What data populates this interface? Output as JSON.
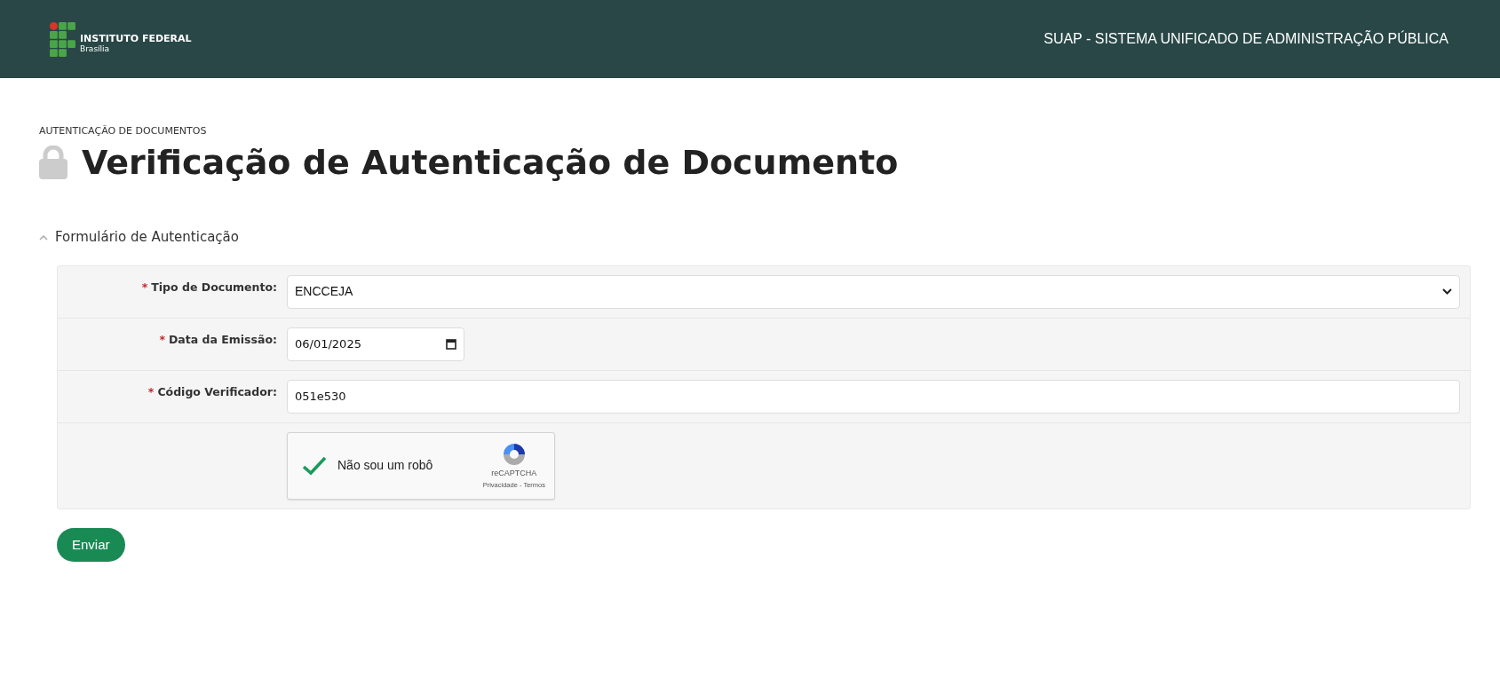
{
  "header": {
    "logo_title": "INSTITUTO FEDERAL",
    "logo_subtitle": "Brasília",
    "system_name": "SUAP - SISTEMA UNIFICADO DE ADMINISTRAÇÃO PÚBLICA"
  },
  "breadcrumb": "AUTENTICAÇÃO DE DOCUMENTOS",
  "page_title": "Verificação de Autenticação de Documento",
  "section": {
    "title": "Formulário de Autenticação",
    "expanded": true
  },
  "fields": [
    {
      "kind": "select",
      "required_mark": "*",
      "label": "Tipo de Documento:",
      "value": "ENCCEJA"
    },
    {
      "kind": "date",
      "required_mark": "*",
      "label": "Data da Emissão:",
      "value": "06/01/2025"
    },
    {
      "kind": "text",
      "required_mark": "*",
      "label": "Código Verificador:",
      "value": "051e530"
    },
    {
      "kind": "captcha",
      "label": "Não sou um robô",
      "checked": true,
      "brand": "reCAPTCHA",
      "links": "Privacidade - Termos"
    }
  ],
  "submit": "Enviar"
}
